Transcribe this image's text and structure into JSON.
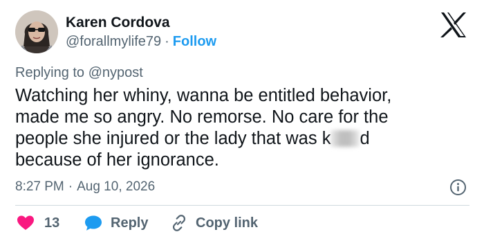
{
  "author": {
    "name": "Karen Cordova",
    "handle": "@forallmylife79",
    "separator": "·",
    "follow_label": "Follow"
  },
  "reply_context": {
    "prefix": "Replying to ",
    "mention": "@nypost"
  },
  "tweet": {
    "lines": [
      "Watching her whiny, wanna be entitled behavior,",
      "made me so angry. No remorse. No care for the",
      "people she injured or the lady that was k",
      "because of her ignorance."
    ],
    "line3_after_blur": "d"
  },
  "meta": {
    "time": "8:27 PM",
    "separator": "·",
    "date": "Aug 10, 2026"
  },
  "actions": {
    "like_count": "13",
    "reply_label": "Reply",
    "copy_label": "Copy link"
  },
  "colors": {
    "like": "#f91880",
    "reply": "#1d9bf0",
    "follow": "#1d9bf0",
    "muted": "#536471",
    "text": "#0f1419"
  },
  "icons": {
    "brand": "x-logo-icon",
    "info": "info-icon",
    "like": "heart-icon",
    "reply": "speech-bubble-icon",
    "copy": "link-icon"
  }
}
